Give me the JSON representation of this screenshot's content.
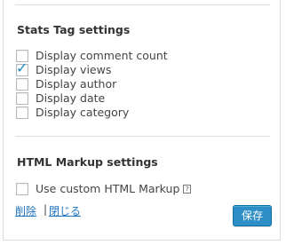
{
  "stats_tag": {
    "title": "Stats Tag settings",
    "options": [
      {
        "label": "Display comment count",
        "checked": false
      },
      {
        "label": "Display views",
        "checked": true
      },
      {
        "label": "Display author",
        "checked": false
      },
      {
        "label": "Display date",
        "checked": false
      },
      {
        "label": "Display category",
        "checked": false
      }
    ]
  },
  "html_markup": {
    "title": "HTML Markup settings",
    "option": {
      "label": "Use custom HTML Markup",
      "checked": false
    },
    "help_glyph": "?"
  },
  "footer": {
    "delete_label": "削除",
    "separator": "|",
    "close_label": "閉じる",
    "save_label": "保存"
  },
  "colors": {
    "accent": "#2e8ec6",
    "link": "#1e73be",
    "check": "#1e8cbe"
  },
  "icons": {
    "checked": "check-icon",
    "help": "help-icon"
  }
}
